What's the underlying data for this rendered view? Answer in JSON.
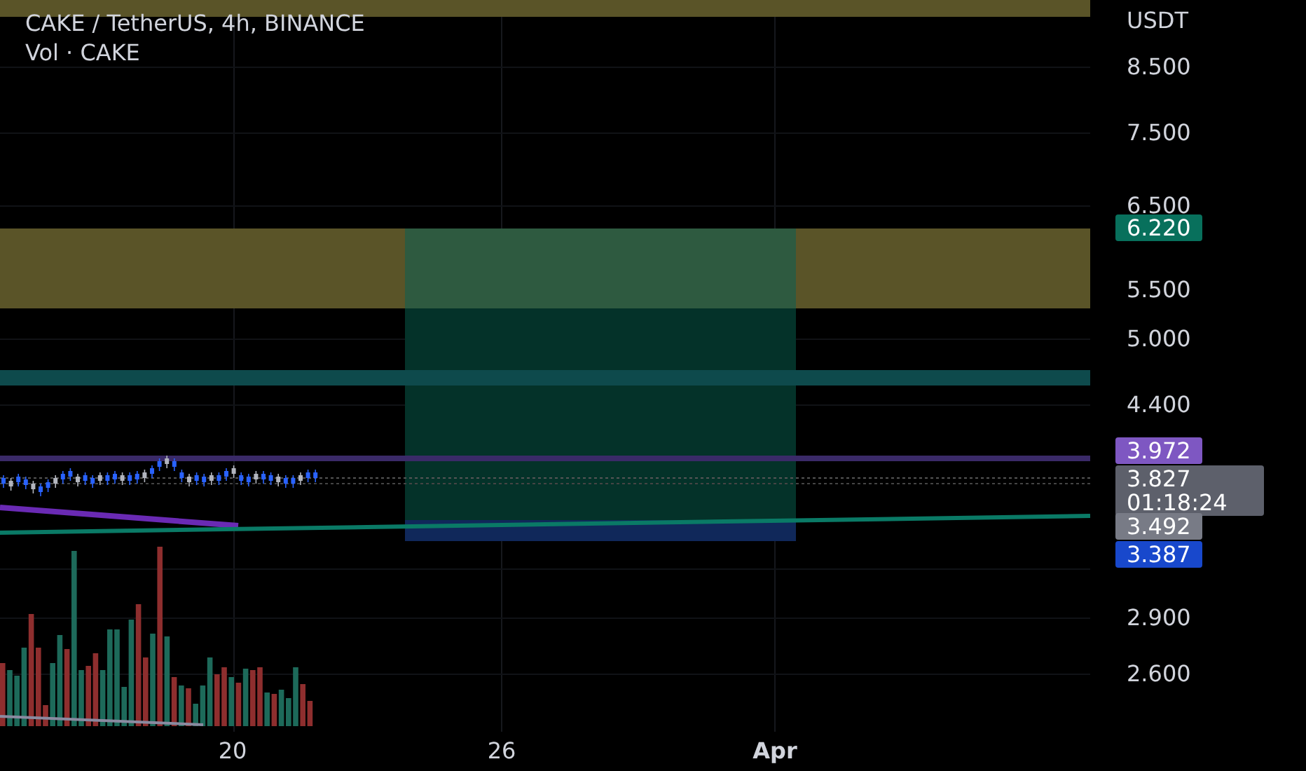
{
  "header": {
    "title": "CAKE / TetherUS, 4h, BINANCE",
    "indicator": "Vol · CAKE"
  },
  "price_axis": {
    "currency": "USDT",
    "labels": [
      "8.500",
      "7.500",
      "6.500",
      "5.500",
      "5.000",
      "4.400",
      "2.900",
      "2.600"
    ],
    "badges": [
      {
        "lines": [
          "6.220"
        ],
        "color": "#08705c"
      },
      {
        "lines": [
          "3.972"
        ],
        "color": "#7e57c2"
      },
      {
        "lines": [
          "3.827",
          "01:18:24"
        ],
        "color": "#5d606b"
      },
      {
        "lines": [
          "3.492"
        ],
        "color": "#787b86"
      },
      {
        "lines": [
          "3.387"
        ],
        "color": "#1848cc"
      }
    ]
  },
  "time_axis": [
    {
      "label": "20",
      "bold": false
    },
    {
      "label": "26",
      "bold": false
    },
    {
      "label": "Apr",
      "bold": true
    }
  ]
}
